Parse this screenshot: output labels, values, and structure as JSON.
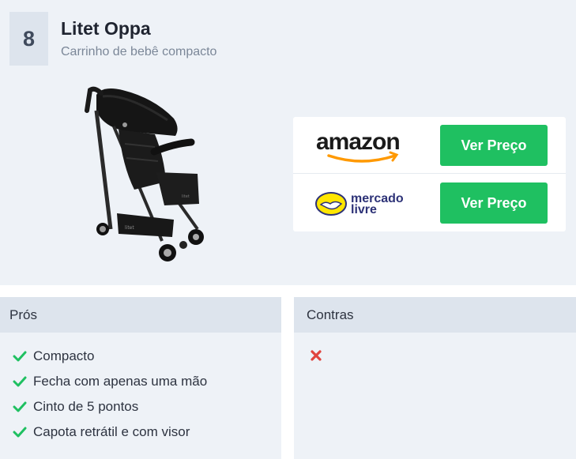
{
  "product": {
    "rank": "8",
    "title": "Litet Oppa",
    "subtitle": "Carrinho de bebê compacto",
    "image_icon": "stroller-image"
  },
  "stores": [
    {
      "name": "amazon",
      "logo_icon": "amazon-logo",
      "button_label": "Ver Preço"
    },
    {
      "name": "mercado livre",
      "logo_line1": "mercado",
      "logo_line2": "livre",
      "logo_icon": "mercado-livre-logo",
      "button_label": "Ver Preço"
    }
  ],
  "pros": {
    "title": "Prós",
    "items": [
      "Compacto",
      "Fecha com apenas uma mão",
      "Cinto de 5 pontos",
      "Capota retrátil e com visor"
    ]
  },
  "cons": {
    "title": "Contras",
    "items": []
  },
  "colors": {
    "button": "#1fc061",
    "check": "#1fc061",
    "cross": "#e0443e",
    "panel_bg": "#eef2f7",
    "header_bg": "#dde4ed",
    "amazon_orange": "#ff9900",
    "mercado_yellow": "#ffe600",
    "mercado_blue": "#2d3277"
  }
}
